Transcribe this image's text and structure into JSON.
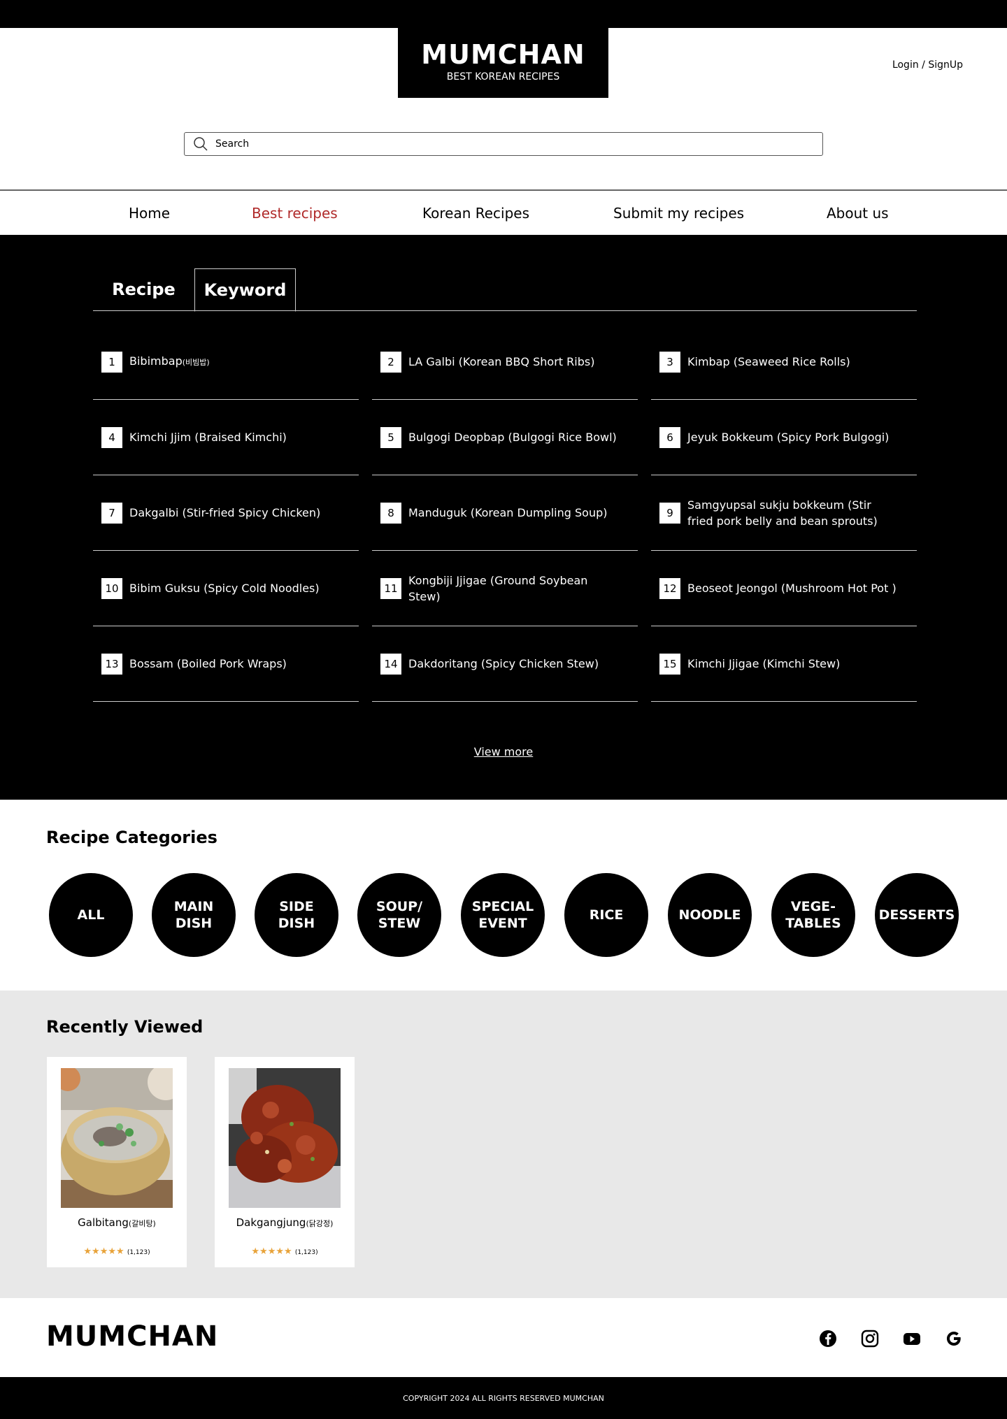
{
  "header": {
    "brand": "MUMCHAN",
    "tagline": "BEST KOREAN RECIPES",
    "login_label": "Login / SignUp",
    "search_placeholder": "Search"
  },
  "nav": {
    "items": [
      {
        "label": "Home"
      },
      {
        "label": "Best recipes",
        "active": true
      },
      {
        "label": "Korean Recipes"
      },
      {
        "label": "Submit my recipes"
      },
      {
        "label": "About us"
      }
    ],
    "active_color": "#b02a2a"
  },
  "ranking": {
    "tabs": [
      {
        "label": "Recipe"
      },
      {
        "label": "Keyword",
        "active": true
      }
    ],
    "items": [
      {
        "rank": "1",
        "name": "Bibimbap",
        "korean": "(비빔밥)"
      },
      {
        "rank": "2",
        "name": "LA Galbi (Korean BBQ Short Ribs)"
      },
      {
        "rank": "3",
        "name": "Kimbap (Seaweed Rice Rolls)"
      },
      {
        "rank": "4",
        "name": "Kimchi Jjim (Braised Kimchi)"
      },
      {
        "rank": "5",
        "name": "Bulgogi Deopbap (Bulgogi Rice Bowl)"
      },
      {
        "rank": "6",
        "name": "Jeyuk Bokkeum (Spicy Pork Bulgogi)"
      },
      {
        "rank": "7",
        "name": "Dakgalbi (Stir-fried Spicy Chicken)"
      },
      {
        "rank": "8",
        "name": "Manduguk (Korean Dumpling Soup)"
      },
      {
        "rank": "9",
        "name": "Samgyupsal sukju bokkeum (Stir fried pork belly and bean sprouts)"
      },
      {
        "rank": "10",
        "name": "Bibim Guksu (Spicy Cold Noodles)"
      },
      {
        "rank": "11",
        "name": "Kongbiji Jjigae (Ground Soybean Stew)"
      },
      {
        "rank": "12",
        "name": "Beoseot Jeongol (Mushroom Hot Pot )"
      },
      {
        "rank": "13",
        "name": "Bossam (Boiled Pork Wraps)"
      },
      {
        "rank": "14",
        "name": "Dakdoritang (Spicy Chicken Stew)"
      },
      {
        "rank": "15",
        "name": "Kimchi Jjigae (Kimchi Stew)"
      }
    ],
    "view_more_label": "View more"
  },
  "categories": {
    "title": "Recipe Categories",
    "items": [
      {
        "label": "ALL"
      },
      {
        "label": "MAIN\nDISH"
      },
      {
        "label": "SIDE\nDISH"
      },
      {
        "label": "SOUP/\nSTEW"
      },
      {
        "label": "SPECIAL\nEVENT"
      },
      {
        "label": "RICE"
      },
      {
        "label": "NOODLE"
      },
      {
        "label": "VEGE-\nTABLES"
      },
      {
        "label": "DESSERTS"
      }
    ]
  },
  "recent": {
    "title": "Recently Viewed",
    "cards": [
      {
        "name": "Galbitang",
        "korean": "(갈비탕)",
        "stars": "★★★★★",
        "count": "(1,123)",
        "image": "galbitang-soup-photo"
      },
      {
        "name": "Dakgangjung",
        "korean": "(닭강정)",
        "stars": "★★★★★",
        "count": "(1,123)",
        "image": "dakgangjung-chicken-photo"
      }
    ],
    "star_color": "#e8a33a"
  },
  "footer": {
    "brand": "MUMCHAN",
    "social": [
      "facebook-icon",
      "instagram-icon",
      "youtube-icon",
      "google-icon"
    ],
    "copyright": "COPYRIGHT 2024 ALL RIGHTS RESERVED MUMCHAN"
  }
}
